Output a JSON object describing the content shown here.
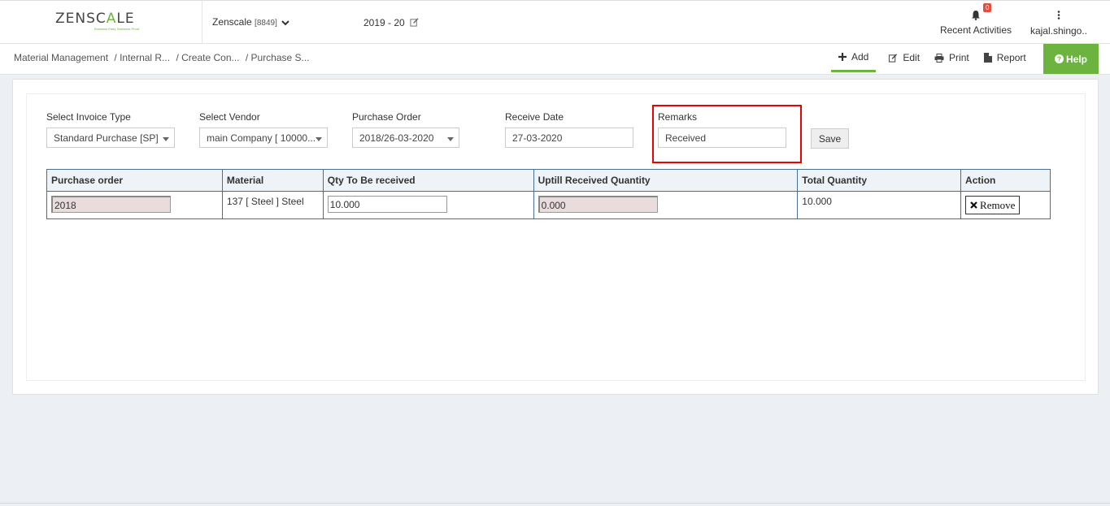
{
  "brand": {
    "logo_main": "ZENSC",
    "logo_mid": "A",
    "logo_end": "LE",
    "tagline": "Business Easy. Business Proof.",
    "accent": "#6cb33f"
  },
  "header": {
    "company_name": "Zenscale",
    "company_code": "[8849]",
    "fiscal_year": "2019 - 20",
    "activities_label": "Recent Activities",
    "activities_count": "0",
    "user_name": "kajal.shingo.."
  },
  "breadcrumb": [
    "Material Management",
    "/ Internal R...",
    "/ Create Con...",
    "/ Purchase S..."
  ],
  "toolbar": {
    "add": "Add",
    "edit": "Edit",
    "print": "Print",
    "report": "Report",
    "help": "Help"
  },
  "form": {
    "invoice_type_label": "Select Invoice Type",
    "invoice_type_value": "Standard Purchase [SP]",
    "vendor_label": "Select Vendor",
    "vendor_value": "main Company [ 10000...",
    "po_label": "Purchase Order",
    "po_value": "2018/26-03-2020",
    "date_label": "Receive Date",
    "date_value": "27-03-2020",
    "remarks_label": "Remarks",
    "remarks_value": "Received",
    "save_label": "Save"
  },
  "table": {
    "headers": [
      "Purchase order",
      "Material",
      "Qty To Be received",
      "Uptill Received Quantity",
      "Total Quantity",
      "Action"
    ],
    "rows": [
      {
        "purchase_order": "2018",
        "material": "137 [ Steel ] Steel",
        "qty_to_receive": "10.000",
        "uptill_received": "0.000",
        "total_quantity": "10.000",
        "action": "Remove"
      }
    ]
  }
}
